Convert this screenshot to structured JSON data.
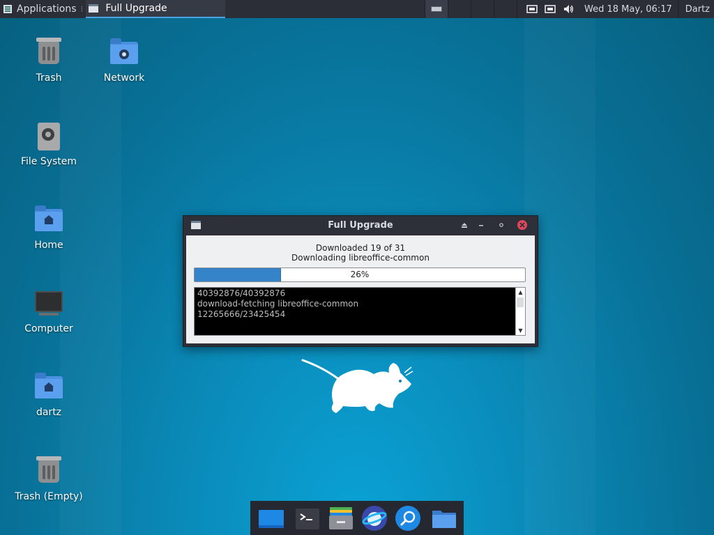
{
  "panel": {
    "applications_label": "Applications",
    "task_label": "Full Upgrade",
    "clock": "Wed 18 May, 06:17",
    "user": "Dartz",
    "icons": [
      "menu-icon",
      "window-icon",
      "workspace-icon",
      "network-icon",
      "network-icon",
      "volume-icon"
    ]
  },
  "desktop": {
    "icons": [
      {
        "label": "Trash",
        "icon": "trash-icon"
      },
      {
        "label": "Network",
        "icon": "network-folder-icon"
      },
      {
        "label": "File System",
        "icon": "drive-icon"
      },
      {
        "label": "Home",
        "icon": "home-folder-icon"
      },
      {
        "label": "Computer",
        "icon": "computer-icon"
      },
      {
        "label": "dartz",
        "icon": "home-folder-icon"
      },
      {
        "label": "Trash (Empty)",
        "icon": "trash-icon"
      }
    ]
  },
  "dialog": {
    "title": "Full Upgrade",
    "line1": "Downloaded 19 of 31",
    "line2": "Downloading libreoffice-common",
    "progress_percent": 26,
    "progress_label": "26%",
    "log": [
      "40392876/40392876",
      "download-fetching libreoffice-common",
      "12265666/23425454"
    ]
  },
  "dock": {
    "items": [
      "show-desktop-icon",
      "terminal-icon",
      "file-manager-icon",
      "web-browser-icon",
      "search-icon",
      "folder-icon"
    ]
  },
  "colors": {
    "accent": "#3584c9",
    "panel": "#2b2e37",
    "close": "#e0475b"
  }
}
